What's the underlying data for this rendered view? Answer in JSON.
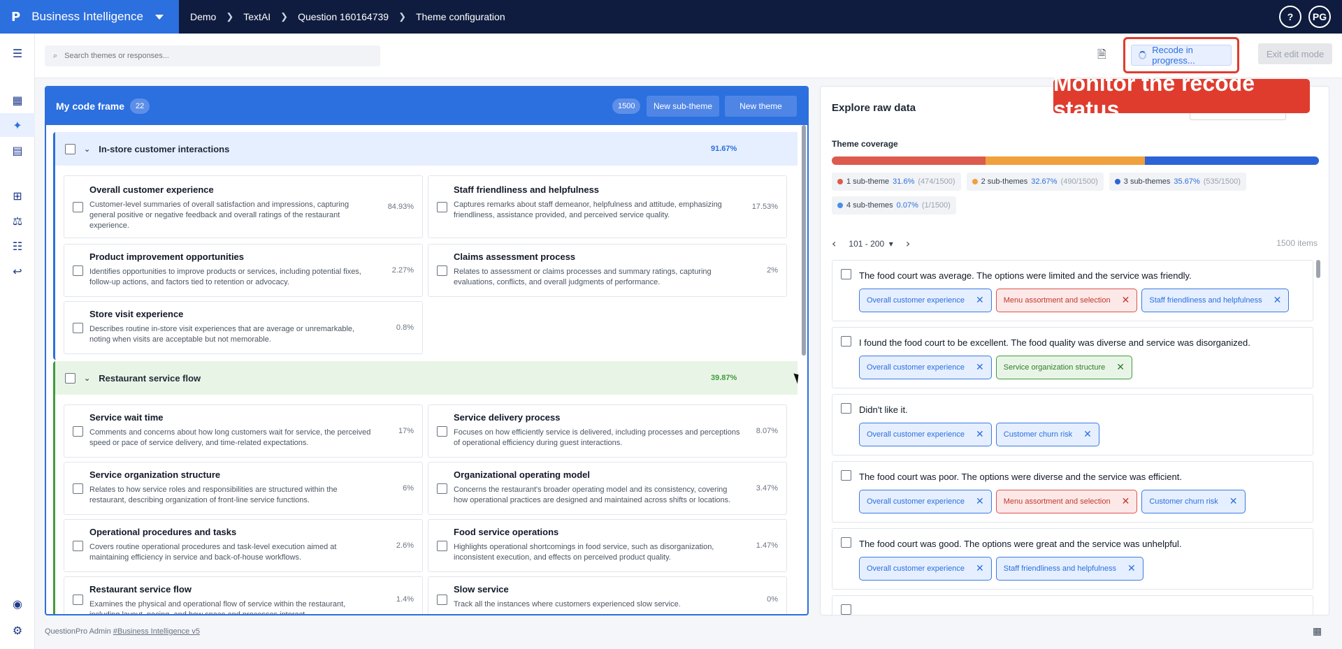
{
  "app": {
    "logo": "P",
    "name": "Business Intelligence"
  },
  "breadcrumbs": [
    "Demo",
    "TextAI",
    "Question 160164739",
    "Theme configuration"
  ],
  "topright": {
    "help": "?",
    "avatar": "PG"
  },
  "toolbar": {
    "search_placeholder": "Search themes or responses...",
    "recode_label": "Recode in progress...",
    "exit_label": "Exit edit mode"
  },
  "callout": "Monitor the recode status.",
  "codeframe": {
    "title": "My code frame",
    "count": "22",
    "responses": "1500",
    "new_subtheme": "New sub-theme",
    "new_theme": "New theme",
    "groups": [
      {
        "name": "In-store customer interactions",
        "pct": "91.67%",
        "cards": [
          {
            "title": "Overall customer experience",
            "desc": "Customer-level summaries of overall satisfaction and impressions, capturing general positive or negative feedback and overall ratings of the restaurant experience.",
            "pct": "84.93%"
          },
          {
            "title": "Staff friendliness and helpfulness",
            "desc": "Captures remarks about staff demeanor, helpfulness and attitude, emphasizing friendliness, assistance provided, and perceived service quality.",
            "pct": "17.53%"
          },
          {
            "title": "Product improvement opportunities",
            "desc": "Identifies opportunities to improve products or services, including potential fixes, follow-up actions, and factors tied to retention or advocacy.",
            "pct": "2.27%"
          },
          {
            "title": "Claims assessment process",
            "desc": "Relates to assessment or claims processes and summary ratings, capturing evaluations, conflicts, and overall judgments of performance.",
            "pct": "2%"
          },
          {
            "title": "Store visit experience",
            "desc": "Describes routine in-store visit experiences that are average or unremarkable, noting when visits are acceptable but not memorable.",
            "pct": "0.8%"
          }
        ]
      },
      {
        "name": "Restaurant service flow",
        "pct": "39.87%",
        "cards": [
          {
            "title": "Service wait time",
            "desc": "Comments and concerns about how long customers wait for service, the perceived speed or pace of service delivery, and time-related expectations.",
            "pct": "17%"
          },
          {
            "title": "Service delivery process",
            "desc": "Focuses on how efficiently service is delivered, including processes and perceptions of operational efficiency during guest interactions.",
            "pct": "8.07%"
          },
          {
            "title": "Service organization structure",
            "desc": "Relates to how service roles and responsibilities are structured within the restaurant, describing organization of front-line service functions.",
            "pct": "6%"
          },
          {
            "title": "Organizational operating model",
            "desc": "Concerns the restaurant's broader operating model and its consistency, covering how operational practices are designed and maintained across shifts or locations.",
            "pct": "3.47%"
          },
          {
            "title": "Operational procedures and tasks",
            "desc": "Covers routine operational procedures and task-level execution aimed at maintaining efficiency in service and back-of-house workflows.",
            "pct": "2.6%"
          },
          {
            "title": "Food service operations",
            "desc": "Highlights operational shortcomings in food service, such as disorganization, inconsistent execution, and effects on perceived product quality.",
            "pct": "1.47%"
          },
          {
            "title": "Restaurant service flow",
            "desc": "Examines the physical and operational flow of service within the restaurant, including layout, pacing, and how space and processes interact.",
            "pct": "1.4%"
          },
          {
            "title": "Slow service",
            "desc": "Track all the instances where customers experienced slow service.",
            "pct": "0%"
          }
        ]
      }
    ]
  },
  "explore": {
    "title": "Explore raw data",
    "coverage_label": "Theme coverage",
    "coverage": [
      {
        "label": "1 sub-theme",
        "pct": "31.6%",
        "count": "(474/1500)",
        "color": "#dc5b4c",
        "fraction": 0.316
      },
      {
        "label": "2 sub-themes",
        "pct": "32.67%",
        "count": "(490/1500)",
        "color": "#f0a03c",
        "fraction": 0.3267
      },
      {
        "label": "3 sub-themes",
        "pct": "35.67%",
        "count": "(535/1500)",
        "color": "#2c63d6",
        "fraction": 0.3567
      },
      {
        "label": "4 sub-themes",
        "pct": "0.07%",
        "count": "(1/1500)",
        "color": "#4a8fe6",
        "fraction": 0.0007
      }
    ],
    "page_range": "101 - 200",
    "items": "1500 items",
    "responses": [
      {
        "text": "The food court was average. The options were limited and the service was friendly.",
        "tags": [
          [
            "Overall customer experience",
            "blue"
          ],
          [
            "Menu assortment and selection",
            "red"
          ],
          [
            "Staff friendliness and helpfulness",
            "blue"
          ]
        ]
      },
      {
        "text": "I found the food court to be excellent. The food quality was diverse and service was disorganized.",
        "tags": [
          [
            "Overall customer experience",
            "blue"
          ],
          [
            "Service organization structure",
            "green"
          ]
        ]
      },
      {
        "text": "Didn't like it.",
        "tags": [
          [
            "Overall customer experience",
            "blue"
          ],
          [
            "Customer churn risk",
            "blue"
          ]
        ]
      },
      {
        "text": "The food court was poor. The options were diverse and the service was efficient.",
        "tags": [
          [
            "Overall customer experience",
            "blue"
          ],
          [
            "Menu assortment and selection",
            "red"
          ],
          [
            "Customer churn risk",
            "blue"
          ]
        ]
      },
      {
        "text": "The food court was good. The options were great and the service was unhelpful.",
        "tags": [
          [
            "Overall customer experience",
            "blue"
          ],
          [
            "Staff friendliness and helpfulness",
            "blue"
          ]
        ]
      }
    ]
  },
  "footer": {
    "text": "QuestionPro Admin",
    "link": "#Business Intelligence v5"
  }
}
